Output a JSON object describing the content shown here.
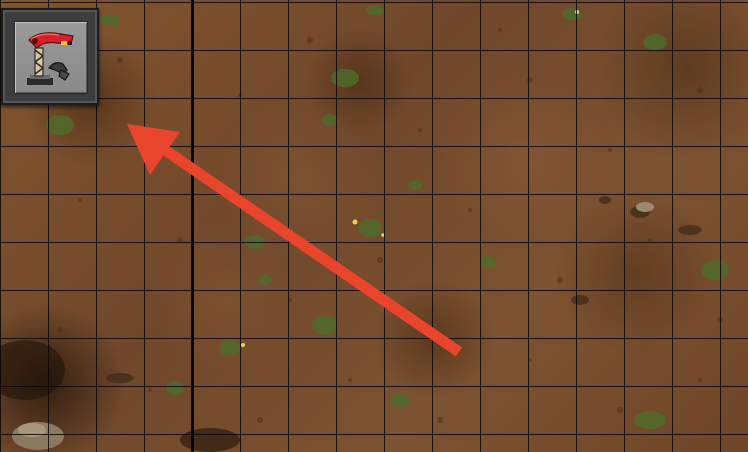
{
  "scene": {
    "view": "game-world-map",
    "terrain": "brown-dirt-desert",
    "grid_visible": true,
    "ground_color": "#7a4f2a",
    "grid_color": "#0a0603"
  },
  "tool_slot": {
    "icon": "inserter-icon",
    "frame_color": "#3d3d3d",
    "icon_bg_color": "#8f8f8f",
    "accent_color": "#d8202a"
  },
  "annotation": {
    "icon": "arrow-icon",
    "color": "#e8452c",
    "points_to": "tool-slot"
  }
}
